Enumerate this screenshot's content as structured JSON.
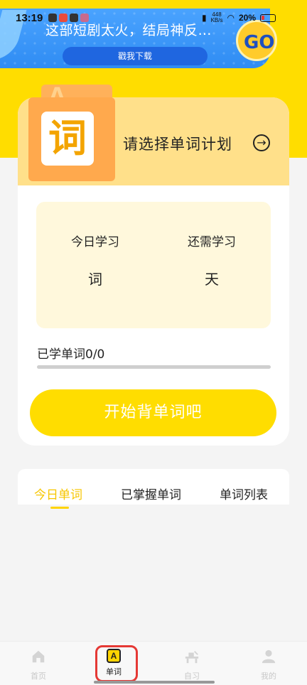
{
  "status_bar": {
    "time": "13:19",
    "net_speed": "448\nKB/s",
    "battery": "20%"
  },
  "ad": {
    "title": "这部短剧太火，结局神反…",
    "button": "戳我下载",
    "go_badge": "GO"
  },
  "plan": {
    "icon_char": "词",
    "title": "请选择单词计划"
  },
  "stats": {
    "today_label": "今日学习",
    "today_value": "词",
    "remain_label": "还需学习",
    "remain_value": "天"
  },
  "progress": {
    "label": "已学单词0/0",
    "learned": 0,
    "total": 0
  },
  "start_button": "开始背单词吧",
  "tabs": [
    {
      "label": "今日单词",
      "active": true
    },
    {
      "label": "已掌握单词",
      "active": false
    },
    {
      "label": "单词列表",
      "active": false
    }
  ],
  "bottom_nav": [
    {
      "label": "首页",
      "icon": "home-icon"
    },
    {
      "label": "单词",
      "icon": "words-icon",
      "icon_char": "A"
    },
    {
      "label": "自习",
      "icon": "study-desk-icon"
    },
    {
      "label": "我的",
      "icon": "person-icon"
    }
  ],
  "colors": {
    "brand_yellow": "#ffdd00",
    "accent_yellow": "#f7c600",
    "highlight_red": "#e53935"
  }
}
